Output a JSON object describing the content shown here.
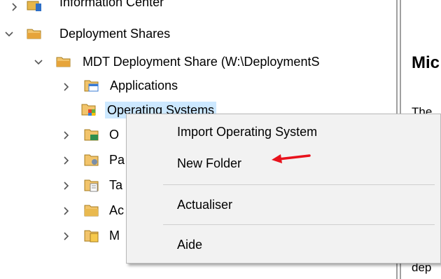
{
  "tree": {
    "information_center": "Information Center",
    "deployment_shares": "Deployment Shares",
    "mdt_share": "MDT Deployment Share (W:\\DeploymentS",
    "applications": "Applications",
    "operating_systems": "Operating Systems",
    "out_of_box_drivers": "O",
    "packages": "Pa",
    "task_sequences": "Ta",
    "advanced_configuration": "Ac",
    "monitoring": "M"
  },
  "right_panel": {
    "title": "Mic",
    "text_1": "The",
    "text_2": "dep"
  },
  "context_menu": {
    "import_os": "Import Operating System",
    "new_folder": "New Folder",
    "refresh": "Actualiser",
    "help": "Aide"
  },
  "colors": {
    "selection": "#cce8ff",
    "arrow": "#e8121c",
    "menu_bg": "#f2f2f2"
  }
}
